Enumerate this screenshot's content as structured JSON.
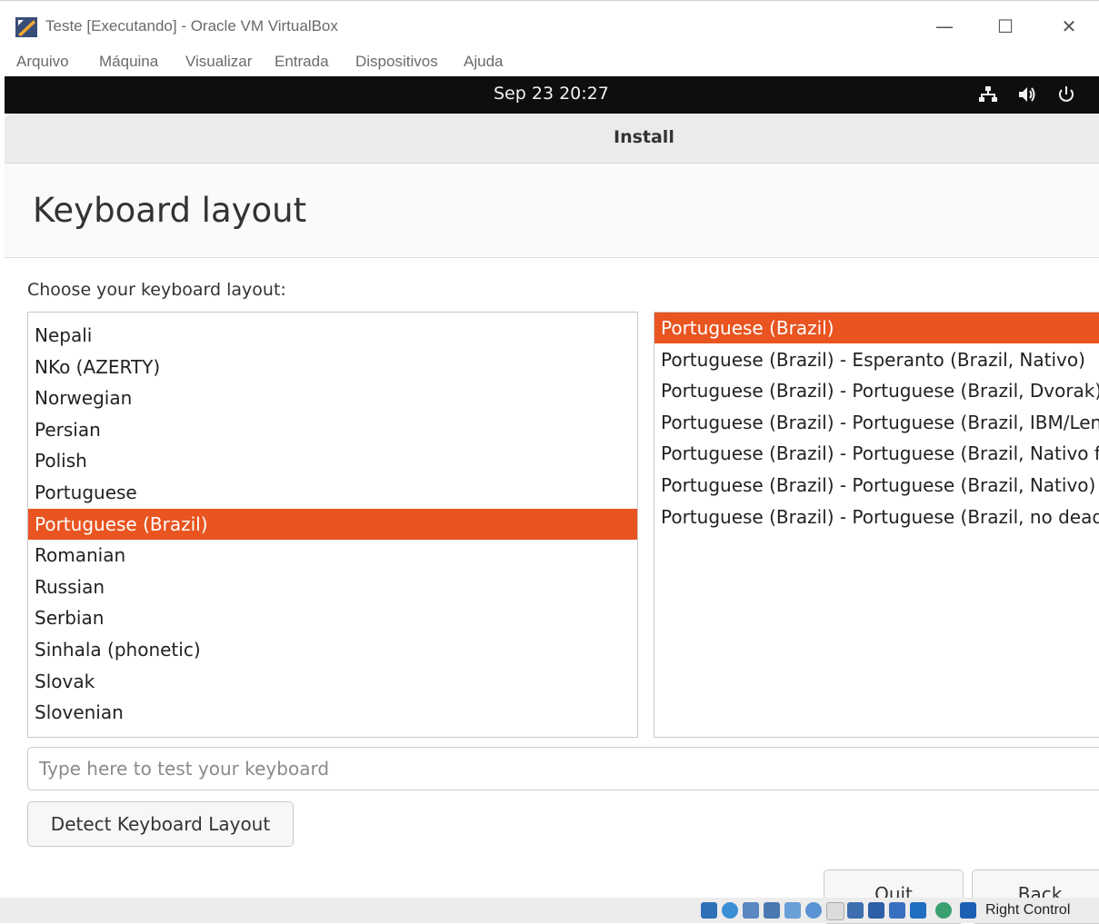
{
  "host_window": {
    "title": "Teste [Executando] - Oracle VM VirtualBox",
    "controls": {
      "minimize": "—",
      "maximize": "☐",
      "close": "✕"
    }
  },
  "host_menu": [
    "Arquivo",
    "Máquina",
    "Visualizar",
    "Entrada",
    "Dispositivos",
    "Ajuda"
  ],
  "topbar": {
    "clock": "Sep 23  20:27",
    "icons": [
      "network-icon",
      "volume-icon",
      "power-icon"
    ]
  },
  "installer": {
    "window_title": "Install",
    "page_title": "Keyboard layout",
    "choose_label": "Choose your keyboard layout:",
    "layouts": [
      "Nepali",
      "NKo (AZERTY)",
      "Norwegian",
      "Persian",
      "Polish",
      "Portuguese",
      "Portuguese (Brazil)",
      "Romanian",
      "Russian",
      "Serbian",
      "Sinhala (phonetic)",
      "Slovak",
      "Slovenian"
    ],
    "selected_layout_index": 6,
    "variants": [
      "Portuguese (Brazil)",
      "Portuguese (Brazil) - Esperanto (Brazil, Nativo)",
      "Portuguese (Brazil) - Portuguese (Brazil, Dvorak)",
      "Portuguese (Brazil) - Portuguese (Brazil, IBM/Lenovo ThinkPad)",
      "Portuguese (Brazil) - Portuguese (Brazil, Nativo for US keyboards)",
      "Portuguese (Brazil) - Portuguese (Brazil, Nativo)",
      "Portuguese (Brazil) - Portuguese (Brazil, no dead keys)"
    ],
    "selected_variant_index": 0,
    "test_placeholder": "Type here to test your keyboard",
    "detect_button": "Detect Keyboard Layout",
    "quit_button": "Quit",
    "back_button": "Back"
  },
  "statusbar": {
    "host_key": "Right Control"
  },
  "colors": {
    "accent": "#e95420",
    "topbar": "#0e0e0e"
  }
}
